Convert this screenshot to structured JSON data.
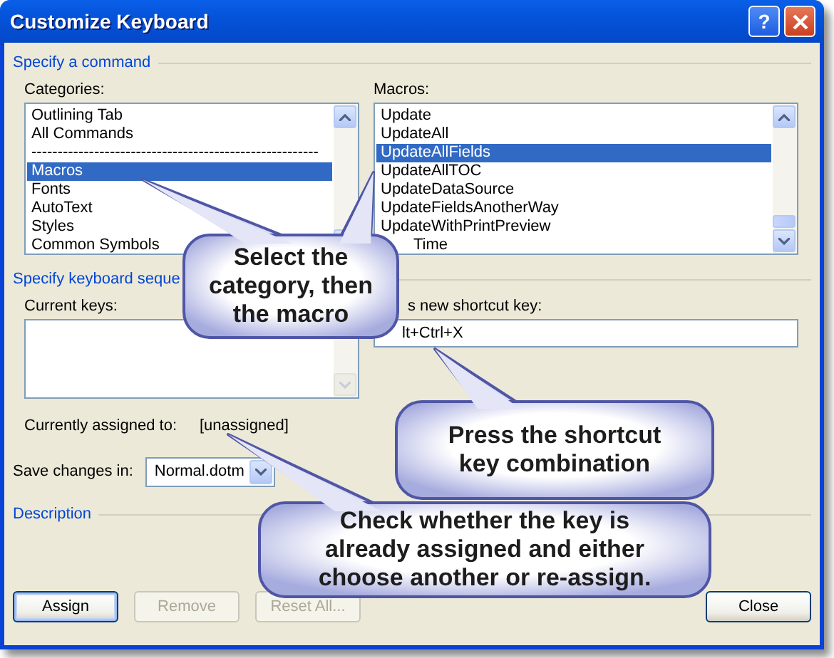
{
  "window": {
    "title": "Customize Keyboard",
    "help_button": "?"
  },
  "specify_command": {
    "heading": "Specify a command",
    "categories": {
      "label": "Categories:",
      "items": [
        {
          "text": "Outlining Tab",
          "selected": false
        },
        {
          "text": "All Commands",
          "selected": false
        },
        {
          "text": "-------------------------------------------------------",
          "selected": false
        },
        {
          "text": "Macros",
          "selected": true
        },
        {
          "text": "Fonts",
          "selected": false
        },
        {
          "text": "AutoText",
          "selected": false
        },
        {
          "text": "Styles",
          "selected": false
        },
        {
          "text": "Common Symbols",
          "selected": false
        }
      ]
    },
    "macros": {
      "label": "Macros:",
      "items": [
        {
          "text": "Update",
          "selected": false
        },
        {
          "text": "UpdateAll",
          "selected": false
        },
        {
          "text": "UpdateAllFields",
          "selected": true
        },
        {
          "text": "UpdateAllTOC",
          "selected": false
        },
        {
          "text": "UpdateDataSource",
          "selected": false
        },
        {
          "text": "UpdateFieldsAnotherWay",
          "selected": false
        },
        {
          "text": "UpdateWithPrintPreview",
          "selected": false
        },
        {
          "text": "Time",
          "selected": false,
          "covered": true
        }
      ]
    }
  },
  "keyboard_sequence": {
    "heading": "Specify keyboard seque",
    "current_keys": {
      "label": "Current keys:"
    },
    "new_shortcut": {
      "label": "s new shortcut key:",
      "value": "lt+Ctrl+X"
    }
  },
  "currently_assigned": {
    "label": "Currently assigned to:",
    "value": "[unassigned]"
  },
  "save_changes": {
    "label": "Save changes in:",
    "value": "Normal.dotm"
  },
  "description": {
    "heading": "Description"
  },
  "buttons": [
    {
      "label": "Assign",
      "disabled": false,
      "default": true
    },
    {
      "label": "Remove",
      "disabled": true,
      "default": false
    },
    {
      "label": "Reset All...",
      "disabled": true,
      "default": false
    },
    {
      "label": "Close",
      "disabled": false,
      "default": false
    }
  ],
  "callouts": [
    {
      "text": "Select the category, then the macro"
    },
    {
      "text": "Press the shortcut key combination"
    },
    {
      "text": "Check whether the key is already assigned and either choose another or re-assign."
    }
  ]
}
